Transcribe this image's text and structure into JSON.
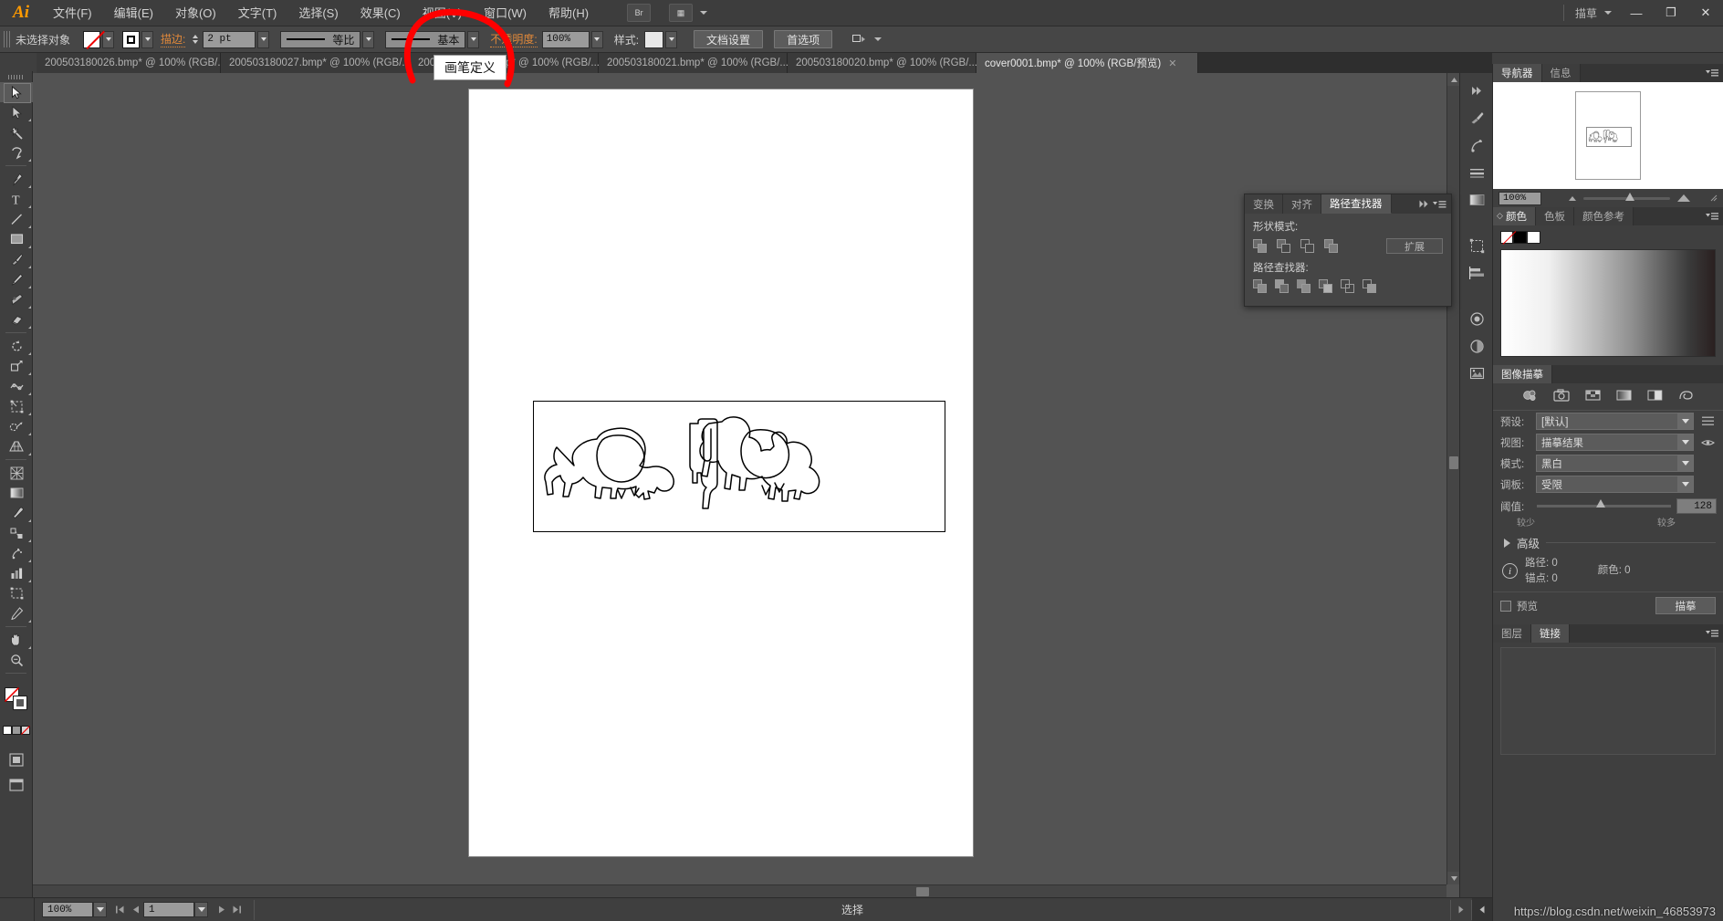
{
  "app": {
    "logo": "Ai",
    "workspace_label": "描草",
    "window_buttons": {
      "minimize": "—",
      "maximize": "❐",
      "close": "✕"
    }
  },
  "menubar": {
    "items": [
      {
        "label": "文件(F)"
      },
      {
        "label": "编辑(E)"
      },
      {
        "label": "对象(O)"
      },
      {
        "label": "文字(T)"
      },
      {
        "label": "选择(S)"
      },
      {
        "label": "效果(C)"
      },
      {
        "label": "视图(V)"
      },
      {
        "label": "窗口(W)"
      },
      {
        "label": "帮助(H)"
      }
    ],
    "bridge_label": "Br",
    "arrange_label": "▦"
  },
  "optionsbar": {
    "selection_status": "未选择对象",
    "stroke_label": "描边:",
    "stroke_value": "2 pt",
    "profile_label": "等比",
    "brush_label": "基本",
    "opacity_label": "不透明度:",
    "opacity_value": "100%",
    "style_label": "样式:",
    "doc_setup_button": "文档设置",
    "preferences_button": "首选项"
  },
  "tabs": [
    {
      "label": "200503180026.bmp* @ 100% (RGB/...",
      "active": false,
      "close": "✕"
    },
    {
      "label": "200503180027.bmp* @ 100% (RGB/...",
      "active": false,
      "close": "✕"
    },
    {
      "label": "200503180028.bmp* @ 100% (RGB/...",
      "active": false,
      "close": "✕"
    },
    {
      "label": "200503180021.bmp* @ 100% (RGB/...",
      "active": false,
      "close": "✕"
    },
    {
      "label": "200503180020.bmp* @ 100% (RGB/...",
      "active": false,
      "close": "✕"
    },
    {
      "label": "cover0001.bmp* @ 100% (RGB/预览)",
      "active": true,
      "close": "✕"
    }
  ],
  "tools": [
    {
      "name": "selection-tool",
      "selected": true
    },
    {
      "name": "direct-selection-tool",
      "selected": false
    },
    {
      "name": "magic-wand-tool",
      "selected": false
    },
    {
      "name": "lasso-tool",
      "selected": false
    },
    {
      "name": "pen-tool",
      "selected": false
    },
    {
      "name": "type-tool",
      "selected": false
    },
    {
      "name": "line-segment-tool",
      "selected": false
    },
    {
      "name": "rectangle-tool",
      "selected": false
    },
    {
      "name": "paintbrush-tool",
      "selected": false
    },
    {
      "name": "pencil-tool",
      "selected": false
    },
    {
      "name": "blob-brush-tool",
      "selected": false
    },
    {
      "name": "eraser-tool",
      "selected": false
    },
    {
      "name": "rotate-tool",
      "selected": false
    },
    {
      "name": "scale-tool",
      "selected": false
    },
    {
      "name": "width-tool",
      "selected": false
    },
    {
      "name": "free-transform-tool",
      "selected": false
    },
    {
      "name": "shape-builder-tool",
      "selected": false
    },
    {
      "name": "perspective-grid-tool",
      "selected": false
    },
    {
      "name": "mesh-tool",
      "selected": false
    },
    {
      "name": "gradient-tool",
      "selected": false
    },
    {
      "name": "eyedropper-tool",
      "selected": false
    },
    {
      "name": "blend-tool",
      "selected": false
    },
    {
      "name": "symbol-sprayer-tool",
      "selected": false
    },
    {
      "name": "column-graph-tool",
      "selected": false
    },
    {
      "name": "artboard-tool",
      "selected": false
    },
    {
      "name": "slice-tool",
      "selected": false
    },
    {
      "name": "hand-tool",
      "selected": false
    },
    {
      "name": "zoom-tool",
      "selected": false
    }
  ],
  "pathfinder": {
    "tabs": [
      {
        "label": "变换",
        "active": false
      },
      {
        "label": "对齐",
        "active": false
      },
      {
        "label": "路径查找器",
        "active": true
      }
    ],
    "shape_modes_label": "形状模式:",
    "expand_button": "扩展",
    "pathfinders_label": "路径查找器:",
    "shape_mode_icons": [
      "unite-icon",
      "minus-front-icon",
      "intersect-icon",
      "exclude-icon"
    ],
    "pathfinder_icons": [
      "divide-icon",
      "trim-icon",
      "merge-icon",
      "crop-icon",
      "outline-icon",
      "minus-back-icon"
    ]
  },
  "navigator": {
    "tabs": [
      {
        "label": "导航器",
        "active": true
      },
      {
        "label": "信息",
        "active": false
      }
    ],
    "zoom_value": "100%"
  },
  "color_panel": {
    "tabs": [
      {
        "label": "颜色",
        "active": true
      },
      {
        "label": "色板",
        "active": false
      },
      {
        "label": "颜色参考",
        "active": false
      }
    ],
    "swatches": [
      "none-swatch",
      "black-swatch",
      "white-swatch"
    ]
  },
  "image_trace": {
    "tab_label": "图像描摹",
    "preset_icons": [
      "auto-color-icon",
      "high-fidelity-photo-icon",
      "low-fidelity-photo-icon",
      "grayscale-icon",
      "black-and-white-icon",
      "outline-icon"
    ],
    "rows": [
      {
        "label": "预设:",
        "value": "[默认]"
      },
      {
        "label": "视图:",
        "value": "描摹结果"
      },
      {
        "label": "模式:",
        "value": "黑白"
      },
      {
        "label": "调板:",
        "value": "受限"
      }
    ],
    "threshold_label": "阈值:",
    "threshold_value": "128",
    "threshold_min_label": "较少",
    "threshold_max_label": "较多",
    "advanced_label": "高级",
    "info_paths_label": "路径: 0",
    "info_colors_label": "颜色: 0",
    "info_anchors_label": "锚点: 0",
    "preview_label": "预览",
    "trace_button": "描摹"
  },
  "layers_panel": {
    "tabs": [
      {
        "label": "图层",
        "active": false
      },
      {
        "label": "链接",
        "active": true
      }
    ]
  },
  "statusbar": {
    "zoom_value": "100%",
    "page_value": "1",
    "status_text": "选择"
  },
  "annotation": {
    "tooltip_text": "画笔定义",
    "highlight_color": "#ff0000"
  },
  "watermark": "https://blog.csdn.net/weixin_46853973"
}
